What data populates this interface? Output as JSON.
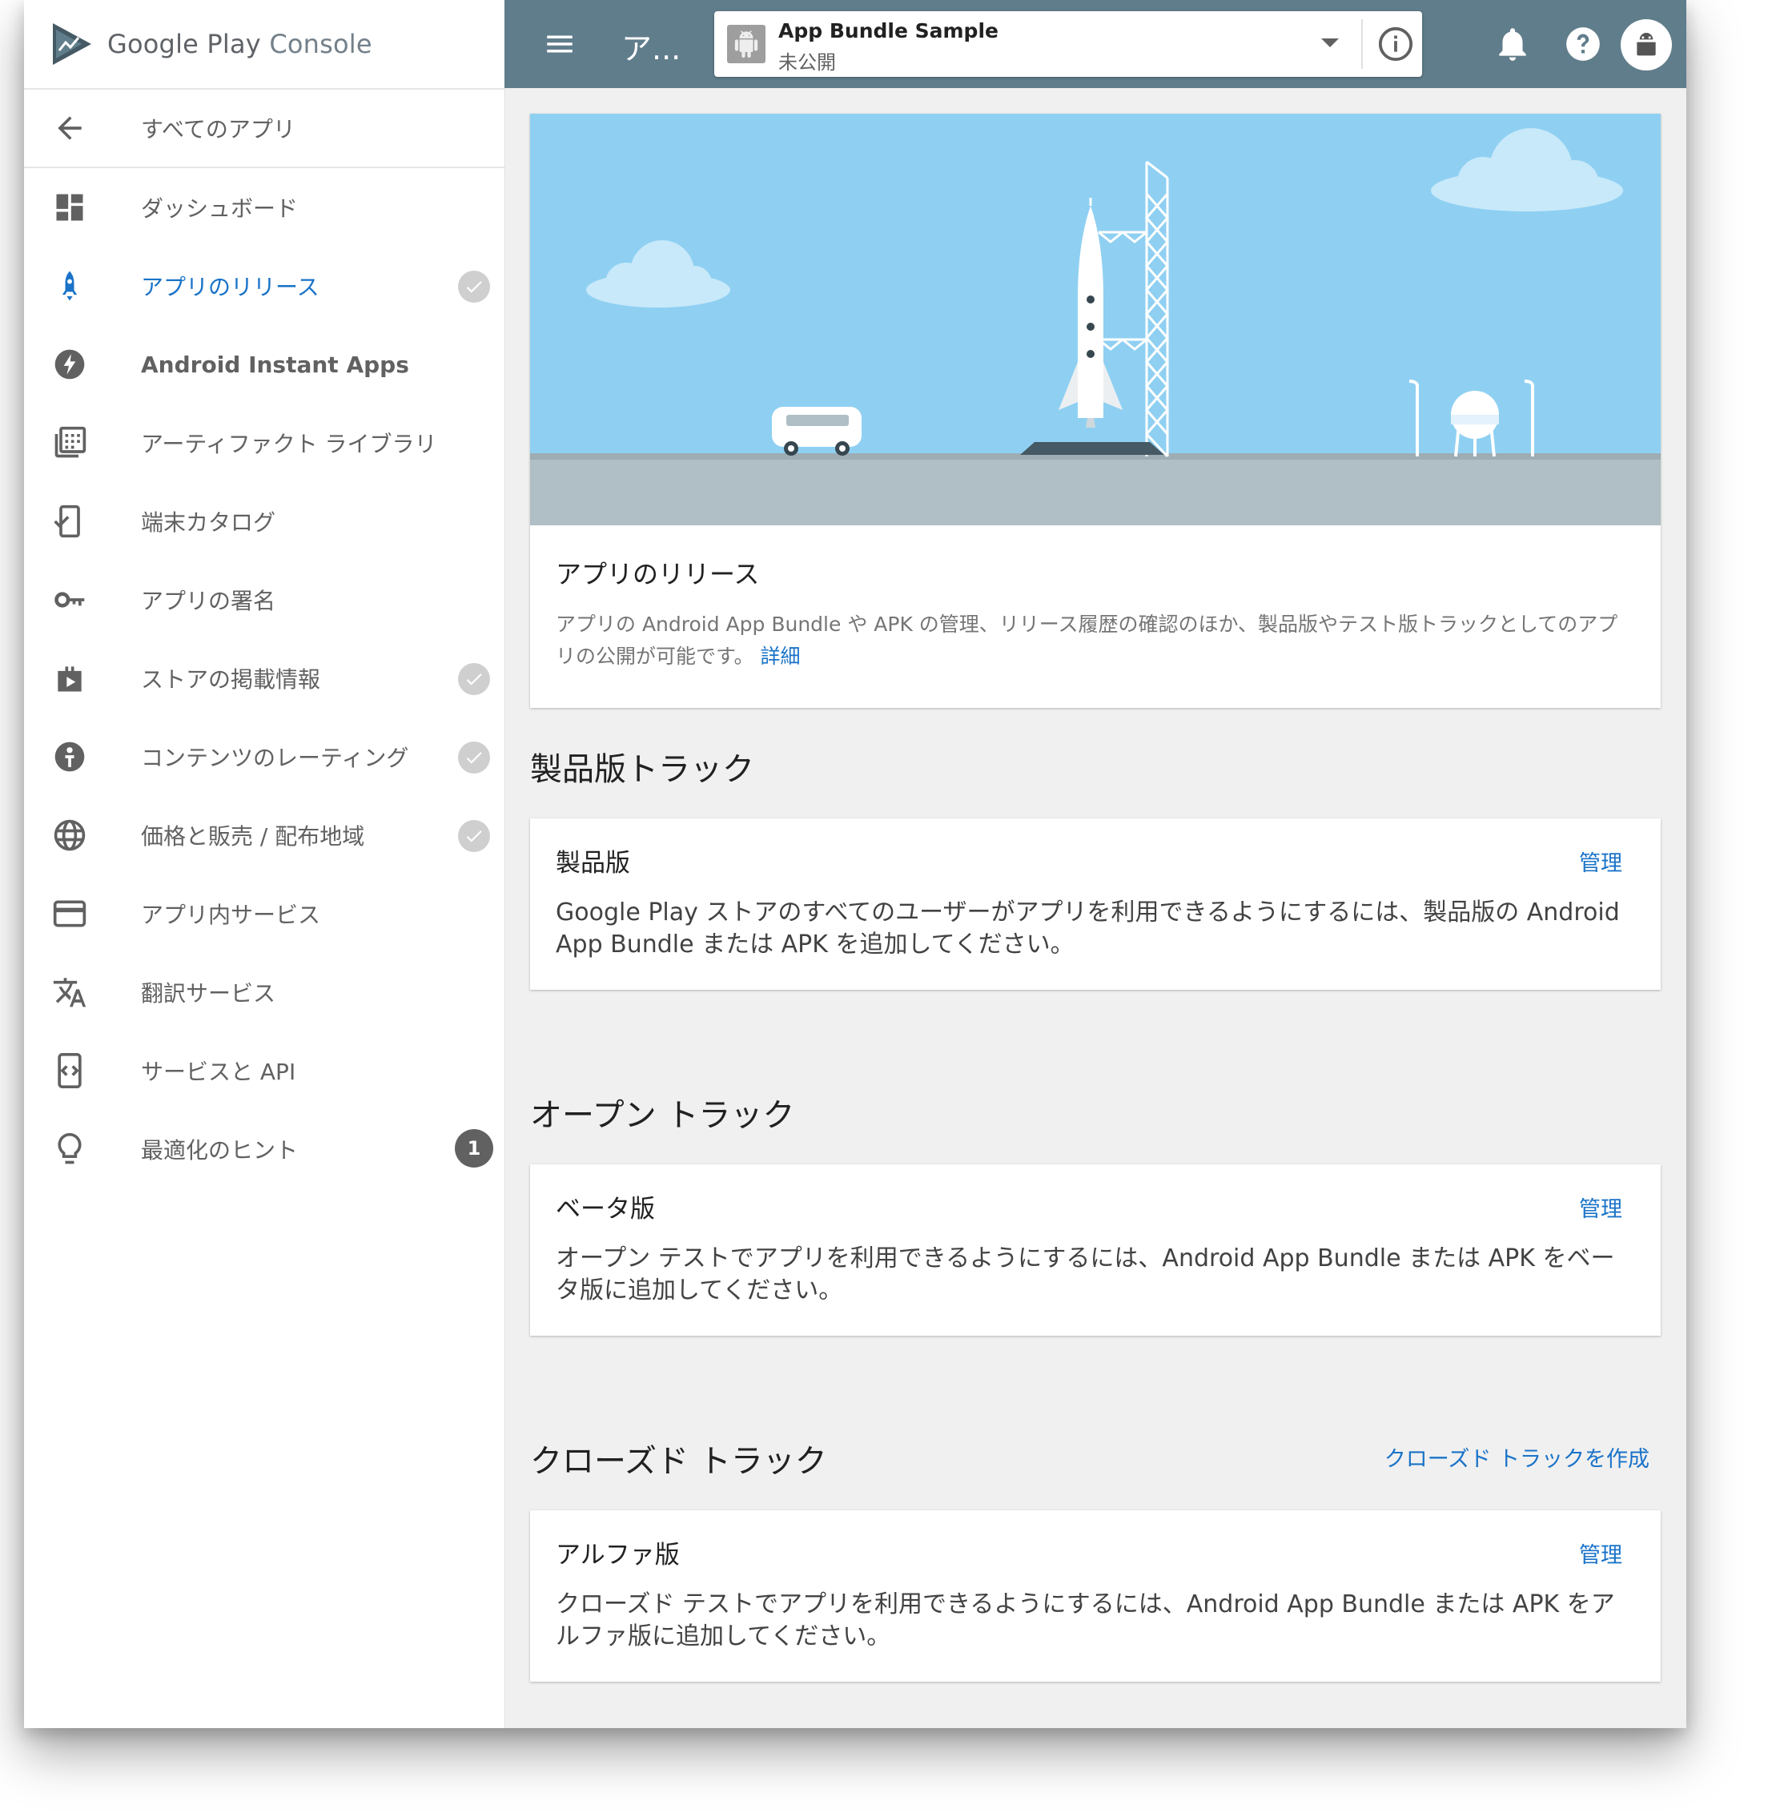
{
  "brand": {
    "google": "Google Play",
    "console": " Console"
  },
  "sidebar": {
    "back_label": "すべてのアプリ",
    "items": [
      {
        "label": "ダッシュボード",
        "icon": "dashboard-icon"
      },
      {
        "label": "アプリのリリース",
        "icon": "rocket-icon",
        "active": true,
        "checked": true
      },
      {
        "label": "Android Instant Apps",
        "icon": "bolt-icon"
      },
      {
        "label": "アーティファクト ライブラリ",
        "icon": "library-icon"
      },
      {
        "label": "端末カタログ",
        "icon": "device-catalog-icon"
      },
      {
        "label": "アプリの署名",
        "icon": "key-icon"
      },
      {
        "label": "ストアの掲載情報",
        "icon": "store-icon",
        "checked": true
      },
      {
        "label": "コンテンツのレーティング",
        "icon": "rating-icon",
        "checked": true
      },
      {
        "label": "価格と販売 / 配布地域",
        "icon": "globe-icon",
        "checked": true
      },
      {
        "label": "アプリ内サービス",
        "icon": "credit-card-icon"
      },
      {
        "label": "翻訳サービス",
        "icon": "translate-icon"
      },
      {
        "label": "サービスと API",
        "icon": "api-icon"
      },
      {
        "label": "最適化のヒント",
        "icon": "lightbulb-icon",
        "badge": "1"
      }
    ]
  },
  "topbar": {
    "title": "ア...",
    "app_name": "App Bundle Sample",
    "app_status": "未公開",
    "color": "#607d8b"
  },
  "hero": {
    "title": "アプリのリリース",
    "description": "アプリの Android App Bundle や APK の管理、リリース履歴の確認のほか、製品版やテスト版トラックとしてのアプリの公開が可能です。",
    "link": "詳細"
  },
  "sections": {
    "production": {
      "title": "製品版トラック",
      "track_title": "製品版",
      "manage": "管理",
      "description": "Google Play ストアのすべてのユーザーがアプリを利用できるようにするには、製品版の Android App Bundle または APK を追加してください。"
    },
    "open": {
      "title": "オープン トラック",
      "track_title": "ベータ版",
      "manage": "管理",
      "description": "オープン テストでアプリを利用できるようにするには、Android App Bundle または APK をベータ版に追加してください。"
    },
    "closed": {
      "title": "クローズド トラック",
      "create_link": "クローズド トラックを作成",
      "track_title": "アルファ版",
      "manage": "管理",
      "description": "クローズド テストでアプリを利用できるようにするには、Android App Bundle または APK をアルファ版に追加してください。"
    }
  },
  "colors": {
    "accent": "#1a73c8",
    "sky": "#8fd0f2",
    "ground": "#b0bec5"
  }
}
